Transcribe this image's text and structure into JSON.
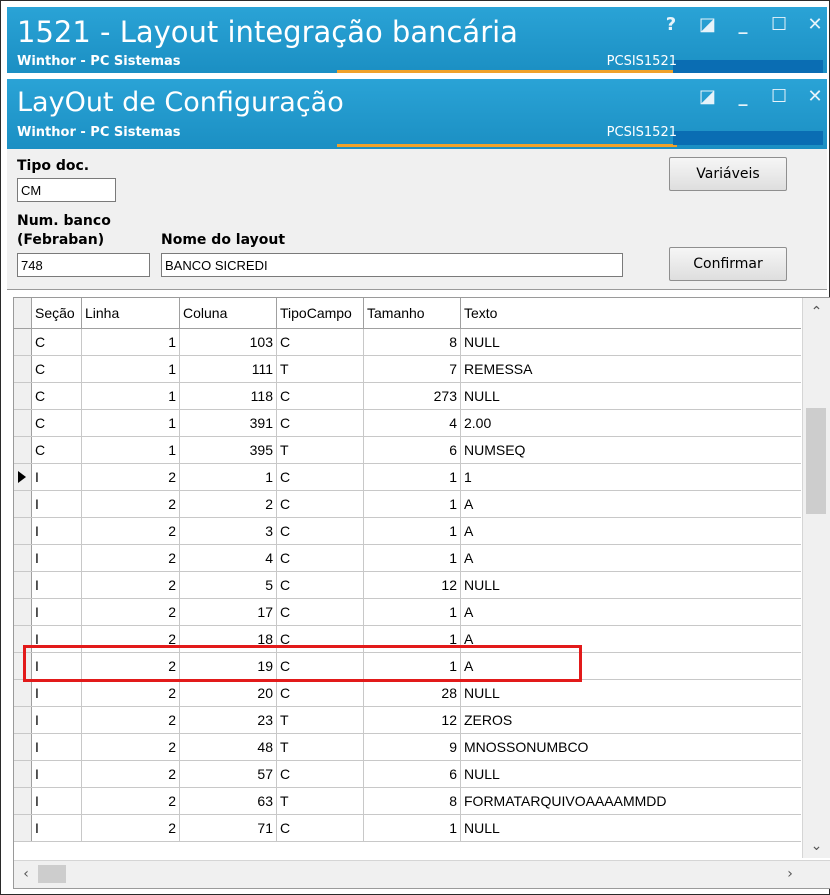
{
  "outer_window": {
    "title": "1521 - Layout integração bancária",
    "subtitle": "Winthor - PC Sistemas",
    "code": "PCSIS1521",
    "controls": [
      "?",
      "◪",
      "_",
      "☐",
      "✕"
    ]
  },
  "inner_window": {
    "title": "LayOut de Configuração",
    "subtitle": "Winthor - PC Sistemas",
    "code": "PCSIS1521",
    "controls": [
      "◪",
      "_",
      "☐",
      "✕"
    ]
  },
  "form": {
    "tipo_doc_label": "Tipo doc.",
    "tipo_doc_value": "CM",
    "num_banco_label": "Num. banco",
    "num_banco_label2": "(Febraban)",
    "num_banco_value": "748",
    "nome_layout_label": "Nome do layout",
    "nome_layout_value": "BANCO SICREDI",
    "variaveis_button": "Variáveis",
    "confirmar_button": "Confirmar"
  },
  "grid": {
    "columns": [
      "Seção",
      "Linha",
      "Coluna",
      "TipoCampo",
      "Tamanho",
      "Texto"
    ],
    "rows": [
      [
        "C",
        "1",
        "103",
        "C",
        "8",
        "NULL"
      ],
      [
        "C",
        "1",
        "111",
        "T",
        "7",
        "REMESSA"
      ],
      [
        "C",
        "1",
        "118",
        "C",
        "273",
        "NULL"
      ],
      [
        "C",
        "1",
        "391",
        "C",
        "4",
        "2.00"
      ],
      [
        "C",
        "1",
        "395",
        "T",
        "6",
        "NUMSEQ"
      ],
      [
        "I",
        "2",
        "1",
        "C",
        "1",
        "1"
      ],
      [
        "I",
        "2",
        "2",
        "C",
        "1",
        "A"
      ],
      [
        "I",
        "2",
        "3",
        "C",
        "1",
        "A"
      ],
      [
        "I",
        "2",
        "4",
        "C",
        "1",
        "A"
      ],
      [
        "I",
        "2",
        "5",
        "C",
        "12",
        "NULL"
      ],
      [
        "I",
        "2",
        "17",
        "C",
        "1",
        "A"
      ],
      [
        "I",
        "2",
        "18",
        "C",
        "1",
        "A"
      ],
      [
        "I",
        "2",
        "19",
        "C",
        "1",
        "A"
      ],
      [
        "I",
        "2",
        "20",
        "C",
        "28",
        "NULL"
      ],
      [
        "I",
        "2",
        "23",
        "T",
        "12",
        "ZEROS"
      ],
      [
        "I",
        "2",
        "48",
        "T",
        "9",
        "MNOSSONUMBCO"
      ],
      [
        "I",
        "2",
        "57",
        "C",
        "6",
        "NULL"
      ],
      [
        "I",
        "2",
        "63",
        "T",
        "8",
        "FORMATARQUIVOAAAAMMDD"
      ],
      [
        "I",
        "2",
        "71",
        "C",
        "1",
        "NULL"
      ]
    ],
    "current_row_index": 5,
    "highlighted_row_index": 12
  },
  "colors": {
    "titlebar": "#1b8fc3",
    "accent_line": "#f0a22a",
    "highlight_box": "#e21a1a"
  }
}
